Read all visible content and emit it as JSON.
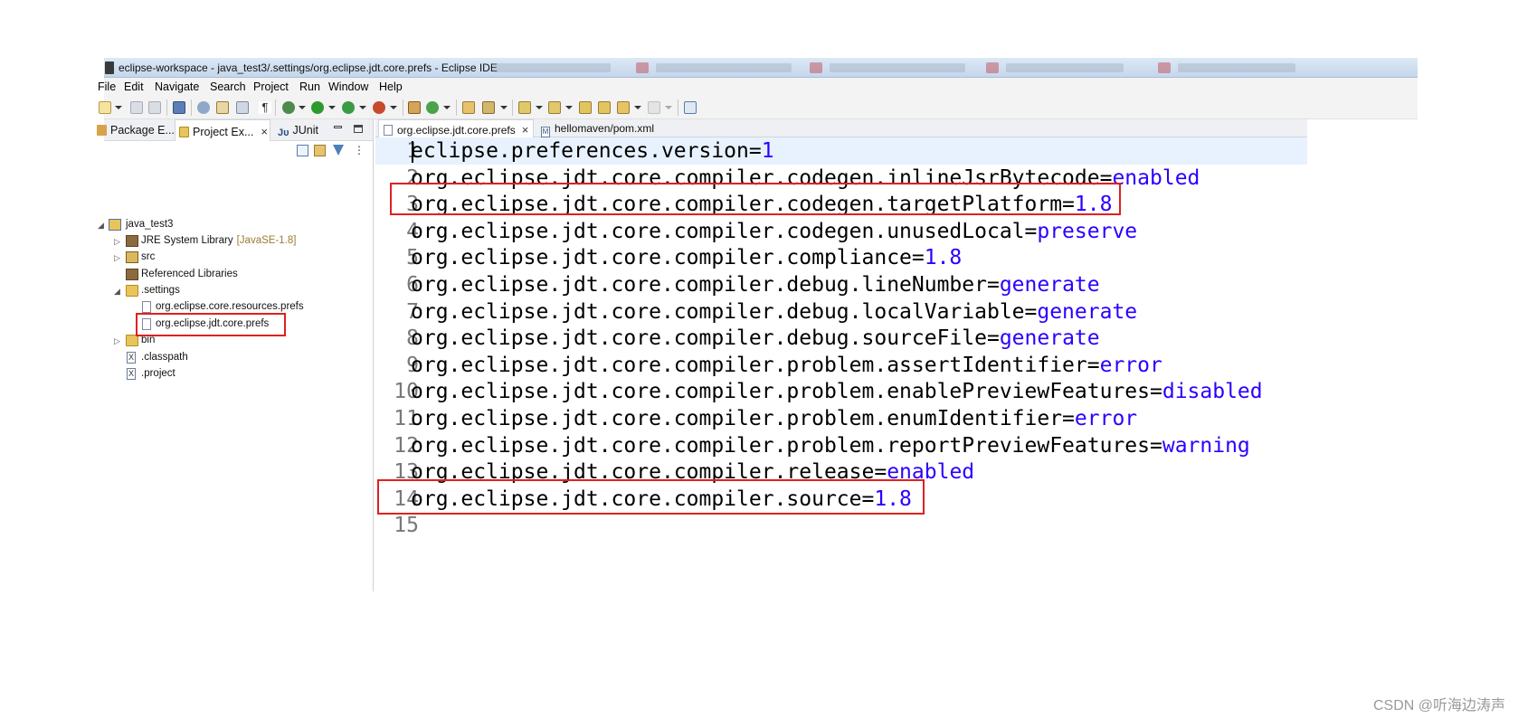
{
  "window": {
    "title": "eclipse-workspace - java_test3/.settings/org.eclipse.jdt.core.prefs - Eclipse IDE"
  },
  "menu": {
    "items": [
      {
        "label": "File"
      },
      {
        "label": "Edit"
      },
      {
        "label": "Navigate"
      },
      {
        "label": "Search"
      },
      {
        "label": "Project"
      },
      {
        "label": "Run"
      },
      {
        "label": "Window"
      },
      {
        "label": "Help"
      }
    ]
  },
  "left_panel": {
    "tabs": [
      {
        "label": "Package E...",
        "icon": "package-explorer-icon"
      },
      {
        "label": "Project Ex...",
        "icon": "project-explorer-icon"
      },
      {
        "label": "JUnit",
        "icon": "junit-icon"
      }
    ],
    "close_glyph": "×",
    "tree": [
      {
        "label": "java_test3",
        "twisty": "◢",
        "icon": "project-icon"
      },
      {
        "label": "JRE System Library",
        "decoration": "[JavaSE-1.8]",
        "twisty": "▷",
        "icon": "library-icon"
      },
      {
        "label": "src",
        "twisty": "▷",
        "icon": "source-folder-icon"
      },
      {
        "label": "Referenced Libraries",
        "twisty": "",
        "icon": "library-icon"
      },
      {
        "label": ".settings",
        "twisty": "◢",
        "icon": "folder-icon"
      },
      {
        "label": "org.eclipse.core.resources.prefs",
        "twisty": "",
        "icon": "file-icon"
      },
      {
        "label": "org.eclipse.jdt.core.prefs",
        "twisty": "",
        "icon": "file-icon"
      },
      {
        "label": "bin",
        "twisty": "▷",
        "icon": "folder-icon"
      },
      {
        "label": ".classpath",
        "twisty": "",
        "icon": "xml-file-icon"
      },
      {
        "label": ".project",
        "twisty": "",
        "icon": "xml-file-icon"
      }
    ]
  },
  "editor": {
    "tabs": [
      {
        "label": "org.eclipse.jdt.core.prefs",
        "active": true,
        "icon": "file-icon"
      },
      {
        "label": "hellomaven/pom.xml",
        "active": false,
        "icon": "maven-file-icon"
      }
    ],
    "lines": [
      {
        "num": "1",
        "key": "eclipse.preferences.version=",
        "value": "1"
      },
      {
        "num": "2",
        "key": "org.eclipse.jdt.core.compiler.codegen.inlineJsrBytecode=",
        "value": "enabled"
      },
      {
        "num": "3",
        "key": "org.eclipse.jdt.core.compiler.codegen.targetPlatform=",
        "value": "1.8"
      },
      {
        "num": "4",
        "key": "org.eclipse.jdt.core.compiler.codegen.unusedLocal=",
        "value": "preserve"
      },
      {
        "num": "5",
        "key": "org.eclipse.jdt.core.compiler.compliance=",
        "value": "1.8"
      },
      {
        "num": "6",
        "key": "org.eclipse.jdt.core.compiler.debug.lineNumber=",
        "value": "generate"
      },
      {
        "num": "7",
        "key": "org.eclipse.jdt.core.compiler.debug.localVariable=",
        "value": "generate"
      },
      {
        "num": "8",
        "key": "org.eclipse.jdt.core.compiler.debug.sourceFile=",
        "value": "generate"
      },
      {
        "num": "9",
        "key": "org.eclipse.jdt.core.compiler.problem.assertIdentifier=",
        "value": "error"
      },
      {
        "num": "10",
        "key": "org.eclipse.jdt.core.compiler.problem.enablePreviewFeatures=",
        "value": "disabled"
      },
      {
        "num": "11",
        "key": "org.eclipse.jdt.core.compiler.problem.enumIdentifier=",
        "value": "error"
      },
      {
        "num": "12",
        "key": "org.eclipse.jdt.core.compiler.problem.reportPreviewFeatures=",
        "value": "warning"
      },
      {
        "num": "13",
        "key": "org.eclipse.jdt.core.compiler.release=",
        "value": "enabled"
      },
      {
        "num": "14",
        "key": "org.eclipse.jdt.core.compiler.source=",
        "value": "1.8"
      },
      {
        "num": "15",
        "key": "",
        "value": ""
      }
    ]
  },
  "highlights": [
    "editor line 3",
    "editor line 14",
    "tree item org.eclipse.jdt.core.prefs"
  ],
  "colors": {
    "value": "#2a00ff",
    "key": "#000000",
    "line_number": "#787878",
    "current_line": "#e8f2fe",
    "highlight_box": "#e02020"
  },
  "watermark": "CSDN @听海边涛声"
}
